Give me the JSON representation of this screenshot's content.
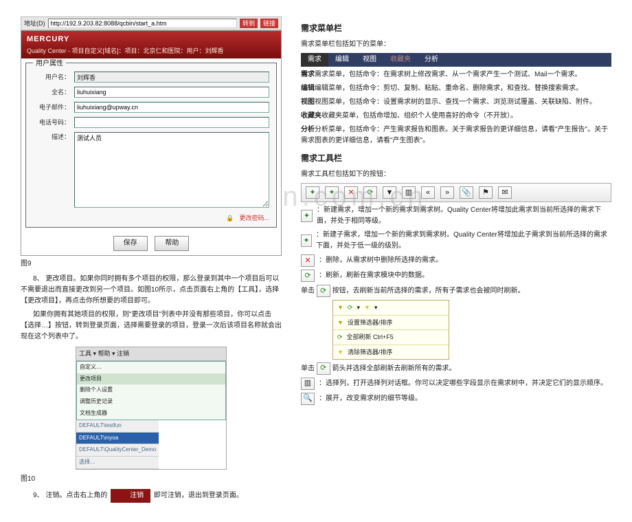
{
  "watermark": "www.zixin.com.cn",
  "left": {
    "addressbar": {
      "label": "地址(D)",
      "url": "http://192.9.203.82:8088/qcbin/start_a.htm",
      "go": "转到",
      "links": "链接"
    },
    "qc": {
      "logo": "MERCURY",
      "title_line": "Quality Center - 项目自定义[域名]：项目：北京仁和医院：用户：刘辉香",
      "panel_title": "用户属性",
      "form": {
        "user_label": "用户名：",
        "user_value": "刘辉香",
        "name_label": "全名：",
        "name_value": "liuhuixiang",
        "email_label": "电子邮件：",
        "email_value": "liuhuixiang@upway.cn",
        "phone_label": "电话号码：",
        "phone_value": "",
        "desc_label": "描述：",
        "desc_value": "测试人员"
      },
      "change_pwd": "更改密码...",
      "btn_save": "保存",
      "btn_help": "帮助"
    },
    "fig9": "图9",
    "para8": "8、 更改项目。如果你同时拥有多个项目的权限，那么登录到其中一个项目后可以不需要退出而直接更改到另一个项目。如图10所示，点击页面右上角的【工具】，选择【更改项目】，再点击你所想要的项目即可。",
    "para8b": "如果你拥有其她项目的权限，则\"更改项目\"列表中并没有那些项目，你可以点击【选择…】按钮，转到登录页面，选择需要登录的项目，登录一次后该项目名称就会出现在这个列表中了。",
    "menu": {
      "toolbar": "工具 ▾  帮助 ▾  注销",
      "l1": "DEFAULT\\testfun",
      "l2": "DEFAULT\\myoa",
      "l3": "DEFAULT\\QualityCenter_Demo",
      "r1": "自定义…",
      "r2": "更改项目",
      "r3": "删除个人设置",
      "r4": "调整历史记录",
      "r5": "文档生成器",
      "r6": "选择…"
    },
    "fig10": "图10",
    "para9a": "9、 注销。点击右上角的",
    "logout_btn": "注销",
    "para9b": "即可注销，退出到登录页面。"
  },
  "right": {
    "sec1_title": "需求菜单栏",
    "sec1_intro": "需求菜单栏包括如下的菜单：",
    "menubar": {
      "m1": "需求",
      "m2": "编辑",
      "m3": "视图",
      "m4": "收藏夹",
      "m5": "分析"
    },
    "line_req": "需求菜单，包括命令：在需求树上修改需求、从一个需求产生一个测试、Mail一个需求。",
    "line_edit": "编辑菜单，包括命令：剪切、复制、粘贴、重命名、删除需求，和查找、替换搜索需求。",
    "line_view": "视图菜单，包括命令：设置需求树的显示、查找一个需求、浏览测试覆盖、关联缺陷、附件。",
    "line_fav": "收藏夹菜单，包括命增加、组织个人使用喜好的命令（不开放）。",
    "line_ana": "分析菜单，包括命令：产生需求报告和图表。关于需求报告的更详细信息，请看\"产生报告\"。关于需求图表的更详细信息，请看\"产生图表\"。",
    "sec2_title": "需求工具栏",
    "sec2_intro": "需求工具栏包括如下的按钮：",
    "tool_new": "：新建需求，增加一个新的需求到需求树。Quality Center将增加此需求到当前所选择的需求下面，并处于相同等级。",
    "tool_child": "：新建子需求，增加一个新的需求到需求树。Quality Center将增加此子需求到当前所选择的需求下面，并处于低一级的级别。",
    "tool_del": "：删除，从需求树中删除所选择的需求。",
    "tool_refresh": "：刷新，刷新在需求模块中的数据。",
    "singleclick_prefix": "单击",
    "tool_refresh2": "按钮，去刷新当前所选择的需求，所有子需求也会被同时刷新。",
    "dropdown": {
      "d1": "设置筛选器/排序",
      "d2": "全部刷新   Ctrl+F5",
      "d3": "清除筛选器/排序"
    },
    "refresh_all_line_a": "单击",
    "refresh_all_line_b": "箭头并选择全部刷新去刷新所有的需求。",
    "tool_cols": "：选择列，打开选择列对话框。你可以决定哪些字段显示在需求树中，并决定它们的显示顺序。",
    "tool_zoom": "：展开，改变需求树的细节等级。"
  }
}
